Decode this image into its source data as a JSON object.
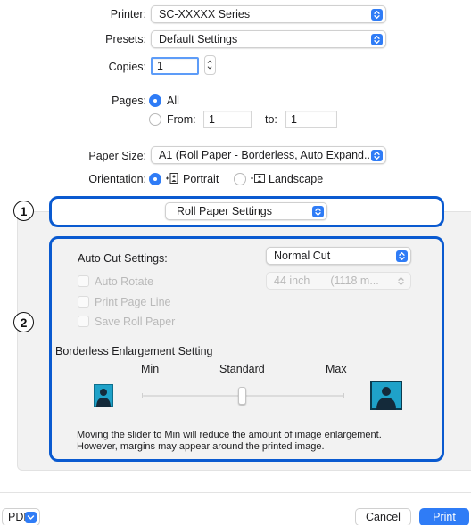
{
  "printer": {
    "label": "Printer:",
    "value": "SC-XXXXX Series"
  },
  "presets": {
    "label": "Presets:",
    "value": "Default Settings"
  },
  "copies": {
    "label": "Copies:",
    "value": "1"
  },
  "pages": {
    "label": "Pages:",
    "all_label": "All",
    "from_label": "From:",
    "from_value": "1",
    "to_label": "to:",
    "to_value": "1",
    "selected": "All"
  },
  "paper_size": {
    "label": "Paper Size:",
    "value": "A1 (Roll Paper - Borderless, Auto Expand..."
  },
  "orientation": {
    "label": "Orientation:",
    "portrait_label": "Portrait",
    "landscape_label": "Landscape",
    "selected": "Portrait"
  },
  "section_popup": {
    "value": "Roll Paper Settings"
  },
  "callouts": {
    "one": "1",
    "two": "2"
  },
  "roll_paper": {
    "auto_cut_label": "Auto Cut Settings:",
    "auto_cut_value": "Normal Cut",
    "auto_rotate_label": "Auto Rotate",
    "auto_rotate_width": "44 inch",
    "auto_rotate_width_mm": "(1118 m...",
    "print_page_line_label": "Print Page Line",
    "save_roll_paper_label": "Save Roll Paper"
  },
  "borderless": {
    "title": "Borderless Enlargement Setting",
    "min_label": "Min",
    "standard_label": "Standard",
    "max_label": "Max",
    "slider_level": "Standard",
    "note_line1": "Moving the slider to Min will reduce the amount of image enlargement.",
    "note_line2": "However, margins may appear around the printed image."
  },
  "footer": {
    "pdf_label": "PDF",
    "cancel_label": "Cancel",
    "print_label": "Print"
  },
  "colors": {
    "accent": "#2f7cf6",
    "callout": "#0a5ad0"
  }
}
